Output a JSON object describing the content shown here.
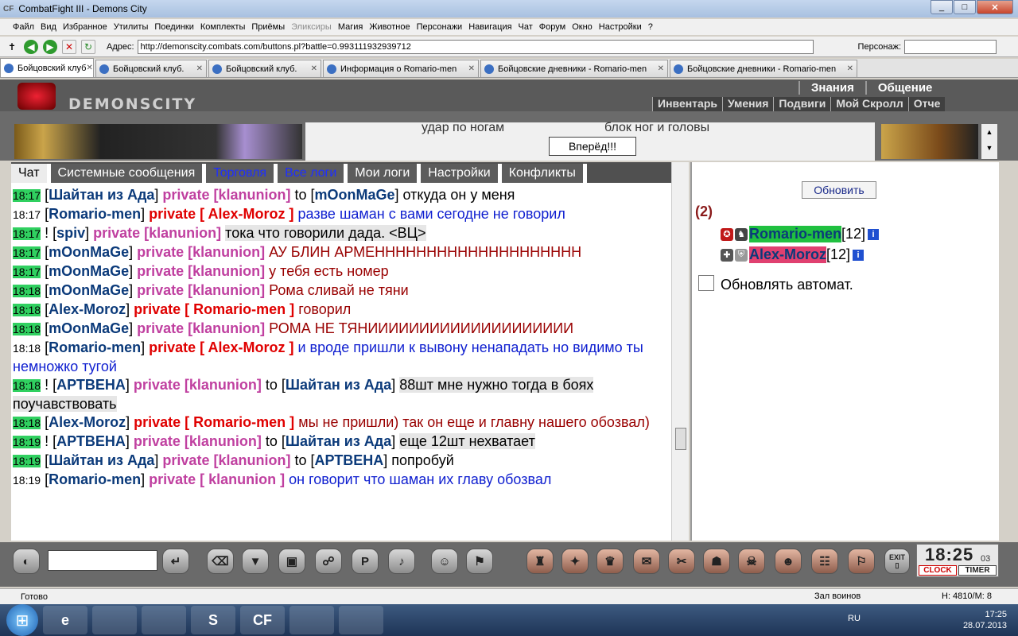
{
  "window": {
    "logo": "CF",
    "title": "CombatFight III - Demons City"
  },
  "menu": [
    "Файл",
    "Вид",
    "Избранное",
    "Утилиты",
    "Поединки",
    "Комплекты",
    "Приёмы",
    "Эликсиры",
    "Магия",
    "Животное",
    "Персонажи",
    "Навигация",
    "Чат",
    "Форум",
    "Окно",
    "Настройки",
    "?"
  ],
  "address": {
    "label": "Адрес:",
    "url": "http://demonscity.combats.com/buttons.pl?battle=0.993111932939712",
    "persona_label": "Персонаж:"
  },
  "browser_tabs": [
    {
      "label": "Бойцовский клуб"
    },
    {
      "label": "Бойцовский клуб."
    },
    {
      "label": "Бойцовский клуб."
    },
    {
      "label": "Информация о Romario-men"
    },
    {
      "label": "Бойцовские дневники - Romario-men"
    },
    {
      "label": "Бойцовские дневники - Romario-men"
    }
  ],
  "game": {
    "logo_text": "DEMONSCITY",
    "topnav": [
      "Знания",
      "Общение"
    ],
    "subnav": [
      "Инвентарь",
      "Умения",
      "Подвиги",
      "Мой Скролл",
      "Отче"
    ]
  },
  "battle": {
    "strike": "удар по ногам",
    "block": "блок ног и головы",
    "forward_button": "Вперёд!!!"
  },
  "chat_tabs": [
    "Чат",
    "Системные сообщения",
    "Торговля",
    "Все логи",
    "Мои логи",
    "Настройки",
    "Конфликты"
  ],
  "messages": [
    {
      "time": "18:17",
      "g": true,
      "pre": "[",
      "name": "Шайтан из Ада",
      "mid": "]",
      "priv": "private [klanunion]",
      "pc": "p1",
      "to": "to [",
      "toname": "mOonMaGe",
      "tail": "]",
      "text": "откуда он у меня",
      "tc": "",
      "hl": false
    },
    {
      "time": "18:17",
      "g": false,
      "pre": "[",
      "name": "Romario-men",
      "mid": "]",
      "priv": "private [ Alex-Moroz ]",
      "pc": "p2",
      "to": "",
      "toname": "",
      "tail": "",
      "text": "разве шаман с вами сегодне не говорил",
      "tc": "blu",
      "hl": false
    },
    {
      "time": "18:17",
      "g": true,
      "pre": "! [",
      "name": "spiv",
      "mid": "]",
      "priv": "private [klanunion]",
      "pc": "p1",
      "to": "",
      "toname": "",
      "tail": "",
      "text": "тока что говорили дада. <ВЦ>",
      "tc": "",
      "hl": true
    },
    {
      "time": "18:17",
      "g": true,
      "pre": "[",
      "name": "mOonMaGe",
      "mid": "]",
      "priv": "private [klanunion]",
      "pc": "p1",
      "to": "",
      "toname": "",
      "tail": "",
      "text": "АУ БЛИН АРМЕНННННННННННННННННННН",
      "tc": "mar",
      "hl": false
    },
    {
      "time": "18:17",
      "g": true,
      "pre": "[",
      "name": "mOonMaGe",
      "mid": "]",
      "priv": "private [klanunion]",
      "pc": "p1",
      "to": "",
      "toname": "",
      "tail": "",
      "text": "у тебя есть номер",
      "tc": "mar",
      "hl": false
    },
    {
      "time": "18:18",
      "g": true,
      "pre": "[",
      "name": "mOonMaGe",
      "mid": "]",
      "priv": "private [klanunion]",
      "pc": "p1",
      "to": "",
      "toname": "",
      "tail": "",
      "text": "Рома сливай не тяни",
      "tc": "mar",
      "hl": false
    },
    {
      "time": "18:18",
      "g": true,
      "pre": "[",
      "name": "Alex-Moroz",
      "mid": "]",
      "priv": "private [ Romario-men ]",
      "pc": "p2",
      "to": "",
      "toname": "",
      "tail": "",
      "text": "говорил",
      "tc": "mar",
      "hl": false
    },
    {
      "time": "18:18",
      "g": true,
      "pre": "[",
      "name": "mOonMaGe",
      "mid": "]",
      "priv": "private [klanunion]",
      "pc": "p1",
      "to": "",
      "toname": "",
      "tail": "",
      "text": "РОМА НЕ ТЯНИИИИИИИИИИИИИИИИИИИИ",
      "tc": "mar",
      "hl": false
    },
    {
      "time": "18:18",
      "g": false,
      "pre": "[",
      "name": "Romario-men",
      "mid": "]",
      "priv": "private [ Alex-Moroz ]",
      "pc": "p2",
      "to": "",
      "toname": "",
      "tail": "",
      "text": "и вроде пришли к вывону ненападать но видимо ты немножко тугой",
      "tc": "blu",
      "hl": false
    },
    {
      "time": "18:18",
      "g": true,
      "pre": "! [",
      "name": "АРТВЕНА",
      "mid": "]",
      "priv": "private [klanunion]",
      "pc": "p1",
      "to": "to [",
      "toname": "Шайтан из Ада",
      "tail": "]",
      "text": "88шт мне нужно тогда в боях поучавствовать",
      "tc": "",
      "hl": true
    },
    {
      "time": "18:18",
      "g": true,
      "pre": "[",
      "name": "Alex-Moroz",
      "mid": "]",
      "priv": "private [ Romario-men ]",
      "pc": "p2",
      "to": "",
      "toname": "",
      "tail": "",
      "text": "мы не пришли) так он еще и главну нашего обозвал)",
      "tc": "mar",
      "hl": false
    },
    {
      "time": "18:19",
      "g": true,
      "pre": "! [",
      "name": "АРТВЕНА",
      "mid": "]",
      "priv": "private [klanunion]",
      "pc": "p1",
      "to": "to [",
      "toname": "Шайтан из Ада",
      "tail": "]",
      "text": "еще 12шт нехватает",
      "tc": "",
      "hl": true
    },
    {
      "time": "18:19",
      "g": true,
      "pre": "[",
      "name": "Шайтан из Ада",
      "mid": "]",
      "priv": "private [klanunion]",
      "pc": "p1",
      "to": "to [",
      "toname": "АРТВЕНА",
      "tail": "]",
      "text": "попробуй",
      "tc": "",
      "hl": false
    },
    {
      "time": "18:19",
      "g": false,
      "pre": "[",
      "name": "Romario-men",
      "mid": "]",
      "priv": "private [ klanunion ]",
      "pc": "p1",
      "to": "",
      "toname": "",
      "tail": "",
      "text": "он говорит что шаман их главу обозвал",
      "tc": "blu",
      "hl": false
    }
  ],
  "online": {
    "refresh": "Обновить",
    "count": "(2)",
    "users": [
      {
        "name": "Romario-men",
        "level": "[12]",
        "info": "i"
      },
      {
        "name": "Alex-Moroz",
        "level": "[12]",
        "info": "i"
      }
    ],
    "auto": "Обновлять автомат."
  },
  "clock": {
    "time": "18:25",
    "sec": "03",
    "clock": "CLOCK",
    "timer": "TIMER",
    "exit": "EXIT"
  },
  "status": {
    "ready": "Готово",
    "zone": "Зал воинов",
    "hp": "Н: 4810/М: 8"
  },
  "taskbar": {
    "lang": "RU",
    "time": "17:25",
    "date": "28.07.2013",
    "apps": [
      "e",
      "",
      "",
      "S",
      "CF",
      "",
      ""
    ]
  }
}
